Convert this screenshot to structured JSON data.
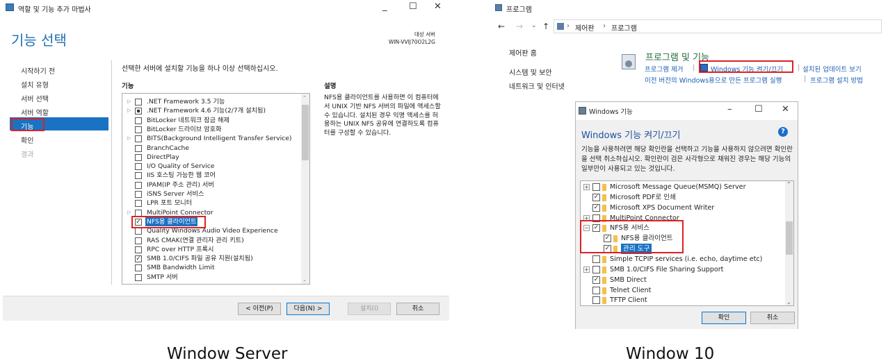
{
  "server": {
    "window_title": "역할 및 기능 추가 마법사",
    "controls": {
      "minimize": "_",
      "maximize": "☐",
      "close": "✕"
    },
    "heading": "기능 선택",
    "dest_label": "대상 서버",
    "dest_server": "WIN-VVIJ70O2L2G",
    "nav": [
      "시작하기 전",
      "설치 유형",
      "서버 선택",
      "서버 역할",
      "기능",
      "확인",
      "결과"
    ],
    "instruction": "선택한 서버에 설치할 기능을 하나 이상 선택하십시오.",
    "features_label": "기능",
    "description_label": "설명",
    "features": [
      {
        "name": ".NET Framework 3.5 기능",
        "expand": true,
        "state": "off"
      },
      {
        "name": ".NET Framework 4.6 기능(2/7개 설치됨)",
        "expand": true,
        "state": "part"
      },
      {
        "name": "BitLocker 네트워크 잠금 해제",
        "expand": false,
        "state": "off"
      },
      {
        "name": "BitLocker 드라이브 암호화",
        "expand": false,
        "state": "off"
      },
      {
        "name": "BITS(Background Intelligent Transfer Service)",
        "expand": true,
        "state": "off"
      },
      {
        "name": "BranchCache",
        "expand": false,
        "state": "off"
      },
      {
        "name": "DirectPlay",
        "expand": false,
        "state": "off"
      },
      {
        "name": "I/O Quality of Service",
        "expand": false,
        "state": "off"
      },
      {
        "name": "IIS 호스팅 가능한 웹 코어",
        "expand": false,
        "state": "off"
      },
      {
        "name": "IPAM(IP 주소 관리) 서버",
        "expand": false,
        "state": "off"
      },
      {
        "name": "iSNS Server 서비스",
        "expand": false,
        "state": "off"
      },
      {
        "name": "LPR 포트 모니터",
        "expand": false,
        "state": "off"
      },
      {
        "name": "MultiPoint Connector",
        "expand": true,
        "state": "off"
      },
      {
        "name": "NFS용 클라이언트",
        "expand": false,
        "state": "on",
        "highlight": true
      },
      {
        "name": "Quality Windows Audio Video Experience",
        "expand": false,
        "state": "off"
      },
      {
        "name": "RAS CMAK(연결 관리자 관리 키트)",
        "expand": false,
        "state": "off"
      },
      {
        "name": "RPC over HTTP 프록시",
        "expand": false,
        "state": "off"
      },
      {
        "name": "SMB 1.0/CIFS 파일 공유 지원(설치됨)",
        "expand": false,
        "state": "on"
      },
      {
        "name": "SMB Bandwidth Limit",
        "expand": false,
        "state": "off"
      },
      {
        "name": "SMTP 서버",
        "expand": false,
        "state": "off"
      }
    ],
    "description": "NFS용 클라이언트를 사용하면 이 컴퓨터에서 UNIX 기반 NFS 서버의 파일에 액세스할 수 있습니다. 설치된 경우 익명 액세스를 허용하는 UNIX NFS 공유에 연결하도록 컴퓨터를 구성할 수 있습니다.",
    "buttons": {
      "prev": "< 이전(P)",
      "next": "다음(N) >",
      "install": "설치(I)",
      "cancel": "취소"
    }
  },
  "control_panel": {
    "window_title": "프로그램",
    "breadcrumb": [
      "제어판",
      "프로그램"
    ],
    "sidebar": [
      "제어판 홈",
      "시스템 및 보안",
      "네트워크 및 인터넷"
    ],
    "section_title": "프로그램 및 기능",
    "links_row1": [
      "프로그램 제거",
      "Windows 기능 켜기/끄기",
      "설치된 업데이트 보기"
    ],
    "links_row2": [
      "이전 버전의 Windows용으로 만든 프로그램 실행",
      "프로그램 설치 방법"
    ]
  },
  "win_features": {
    "window_title": "Windows 기능",
    "heading": "Windows 기능 켜기/끄기",
    "help": "?",
    "description": "기능을 사용하려면 해당 확인란을 선택하고 기능을 사용하지 않으려면 확인란을 선택 취소하십시오. 확인란이 검은 사각형으로 채워진 경우는 해당 기능의 일부만이 사용되고 있는 것입니다.",
    "items": [
      {
        "name": "Microsoft Message Queue(MSMQ) Server",
        "level": 0,
        "expand": "+",
        "checked": false
      },
      {
        "name": "Microsoft PDF로 인쇄",
        "level": 0,
        "expand": "",
        "checked": true
      },
      {
        "name": "Microsoft XPS Document Writer",
        "level": 0,
        "expand": "",
        "checked": true
      },
      {
        "name": "MultiPoint Connector",
        "level": 0,
        "expand": "+",
        "checked": false
      },
      {
        "name": "NFS용 서비스",
        "level": 0,
        "expand": "−",
        "checked": true
      },
      {
        "name": "NFS용 클라이언트",
        "level": 1,
        "expand": "",
        "checked": true
      },
      {
        "name": "관리 도구",
        "level": 1,
        "expand": "",
        "checked": true,
        "highlight": true
      },
      {
        "name": "Simple TCPIP services (i.e. echo, daytime etc)",
        "level": 0,
        "expand": "",
        "checked": false
      },
      {
        "name": "SMB 1.0/CIFS File Sharing Support",
        "level": 0,
        "expand": "+",
        "checked": false
      },
      {
        "name": "SMB Direct",
        "level": 0,
        "expand": "",
        "checked": true
      },
      {
        "name": "Telnet Client",
        "level": 0,
        "expand": "",
        "checked": false
      },
      {
        "name": "TFTP Client",
        "level": 0,
        "expand": "",
        "checked": false
      }
    ],
    "buttons": {
      "ok": "확인",
      "cancel": "취소"
    }
  },
  "captions": {
    "left": "Window Server",
    "right": "Window 10"
  },
  "colors": {
    "accent": "#1a72c3",
    "highlight_box": "#e02020",
    "heading_blue": "#1e6fb3"
  }
}
